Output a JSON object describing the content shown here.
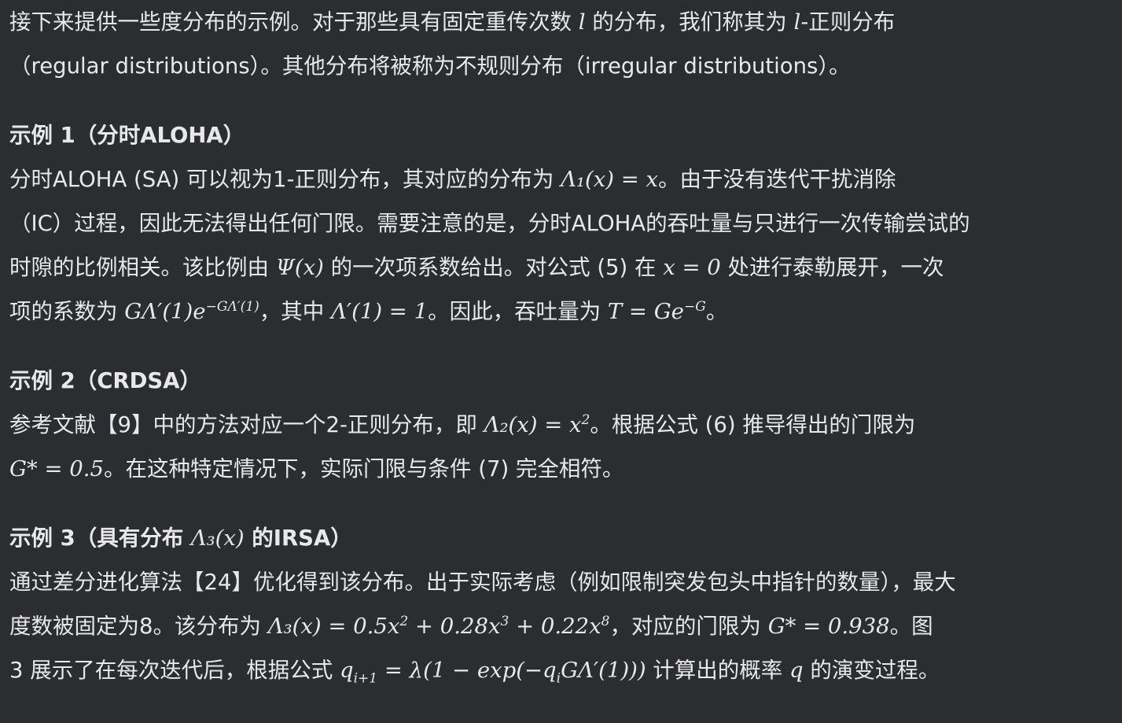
{
  "intro": {
    "line1_a": "接下来提供一些度分布的示例。对于那些具有固定重传次数 ",
    "line1_l": "l",
    "line1_b": " 的分布，我们称其为 ",
    "line1_l2": "l",
    "line1_c": "-正则分布",
    "line2": "（regular distributions）。其他分布将被称为不规则分布（irregular distributions）。"
  },
  "example1": {
    "heading": "示例 1（分时ALOHA）",
    "l1_a": "分时ALOHA (SA) 可以视为1-正则分布，其对应的分布为 ",
    "l1_math": "Λ₁(x) = x",
    "l1_b": "。由于没有迭代干扰消除",
    "l2": "（IC）过程，因此无法得出任何门限。需要注意的是，分时ALOHA的吞吐量与只进行一次传输尝试的",
    "l3_a": "时隙的比例相关。该比例由 ",
    "l3_math1": "Ψ(x)",
    "l3_b": " 的一次项系数给出。对公式 (5) 在 ",
    "l3_math2": "x = 0",
    "l3_c": " 处进行泰勒展开，一次",
    "l4_a": "项的系数为 ",
    "l4_math1": "GΛ′(1)e",
    "l4_sup": "−GΛ′(1)",
    "l4_b": "，其中 ",
    "l4_math2": "Λ′(1) = 1",
    "l4_c": "。因此，吞吐量为 ",
    "l4_math3": "T = Ge",
    "l4_sup2": "−G",
    "l4_d": "。"
  },
  "example2": {
    "heading": "示例 2（CRDSA）",
    "l1_a": "参考文献【9】中的方法对应一个2-正则分布，即 ",
    "l1_math": "Λ₂(x) = x",
    "l1_sup": "2",
    "l1_b": "。根据公式 (6) 推导得出的门限为",
    "l2_math": "G* = 0.5",
    "l2_b": "。在这种特定情况下，实际门限与条件 (7) 完全相符。"
  },
  "example3": {
    "heading_a": "示例 3（具有分布 ",
    "heading_math": "Λ₃(x)",
    "heading_b": " 的IRSA）",
    "l1": "通过差分进化算法【24】优化得到该分布。出于实际考虑（例如限制突发包头中指针的数量），最大",
    "l2_a": "度数被固定为8。该分布为 ",
    "l2_math": "Λ₃(x) = 0.5x",
    "l2_s1": "2",
    "l2_m2": " + 0.28x",
    "l2_s2": "3",
    "l2_m3": " + 0.22x",
    "l2_s3": "8",
    "l2_b": "，对应的门限为 ",
    "l2_math4": "G* = 0.938",
    "l2_c": "。图",
    "l3_a": "3 展示了在每次迭代后，根据公式 ",
    "l3_math": "q",
    "l3_sub": "i+1",
    "l3_math2": " = λ(1 − exp(−q",
    "l3_sub2": "i",
    "l3_math3": "GΛ′(1)))",
    "l3_b": " 计算出的概率 ",
    "l3_q": "q",
    "l3_c": " 的演变过程。"
  }
}
